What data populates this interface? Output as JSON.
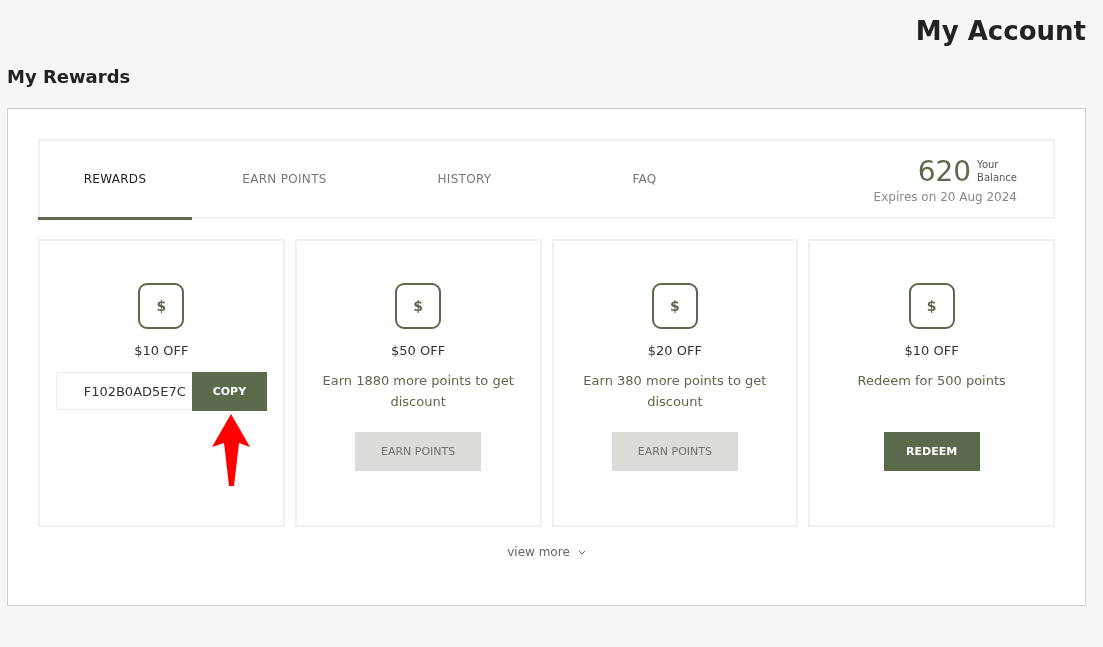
{
  "page_title": "My Account",
  "section_title": "My Rewards",
  "tabs": [
    {
      "label": "REWARDS",
      "selected": true
    },
    {
      "label": "EARN POINTS",
      "selected": false
    },
    {
      "label": "HISTORY",
      "selected": false
    },
    {
      "label": "FAQ",
      "selected": false
    }
  ],
  "balance": {
    "points": "620",
    "label_line_1": "Your",
    "label_line_2": "Balance",
    "expiry": "Expires on 20 Aug 2024"
  },
  "rewards": [
    {
      "kind": "code",
      "title": "$10 OFF",
      "icon": "$",
      "code": "F102B0AD5E7C",
      "button": "COPY",
      "annotated": true
    },
    {
      "kind": "action",
      "title": "$50 OFF",
      "icon": "$",
      "text": "Earn 1880 more points to get discount",
      "button": "EARN POINTS",
      "disabled": true
    },
    {
      "kind": "action",
      "title": "$20 OFF",
      "icon": "$",
      "text": "Earn 380 more points to get discount",
      "button": "EARN POINTS",
      "disabled": true
    },
    {
      "kind": "action",
      "title": "$10 OFF",
      "icon": "$",
      "text": "Redeem for 500 points",
      "button": "REDEEM",
      "disabled": false
    }
  ],
  "view_more": "view more"
}
